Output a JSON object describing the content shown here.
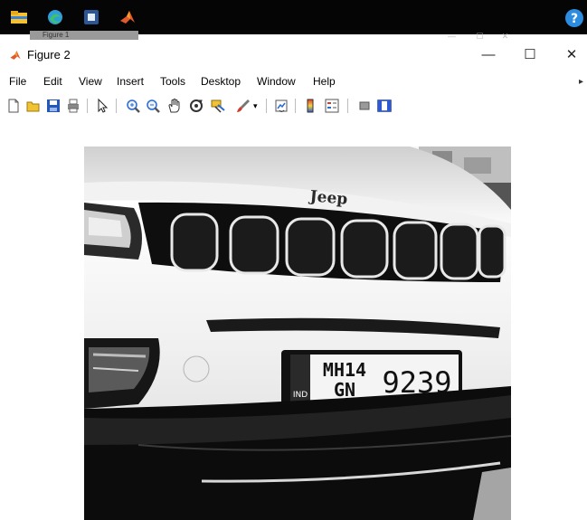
{
  "taskbar": {
    "items": [
      "file-explorer-icon",
      "edge-browser-icon",
      "word-document-icon",
      "matlab-icon",
      "help-icon"
    ],
    "background_tab_label": "Figure 1"
  },
  "window": {
    "title": "Figure 2",
    "buttons": {
      "minimize": "—",
      "maximize": "☐",
      "close": "✕"
    }
  },
  "menu": [
    "File",
    "Edit",
    "View",
    "Insert",
    "Tools",
    "Desktop",
    "Window",
    "Help"
  ],
  "menu_overflow": "▸",
  "toolbar": [
    "new-figure-icon",
    "open-file-icon",
    "save-icon",
    "print-icon",
    "pointer-icon",
    "zoom-in-icon",
    "zoom-out-icon",
    "pan-icon",
    "rotate-3d-icon",
    "data-cursor-icon",
    "brush-icon",
    "brush-dropdown-icon",
    "link-plot-icon",
    "insert-colorbar-icon",
    "insert-legend-icon",
    "hide-plot-tools-icon",
    "show-plot-tools-icon"
  ],
  "image": {
    "description_colors": {
      "car_body": "#f2f2f2",
      "grille": "#111111",
      "background": "#ffffff"
    },
    "badge_text": "Jeep",
    "plate": {
      "country": "IND",
      "line1": "MH14",
      "line2": "GN",
      "number": "9239"
    }
  }
}
